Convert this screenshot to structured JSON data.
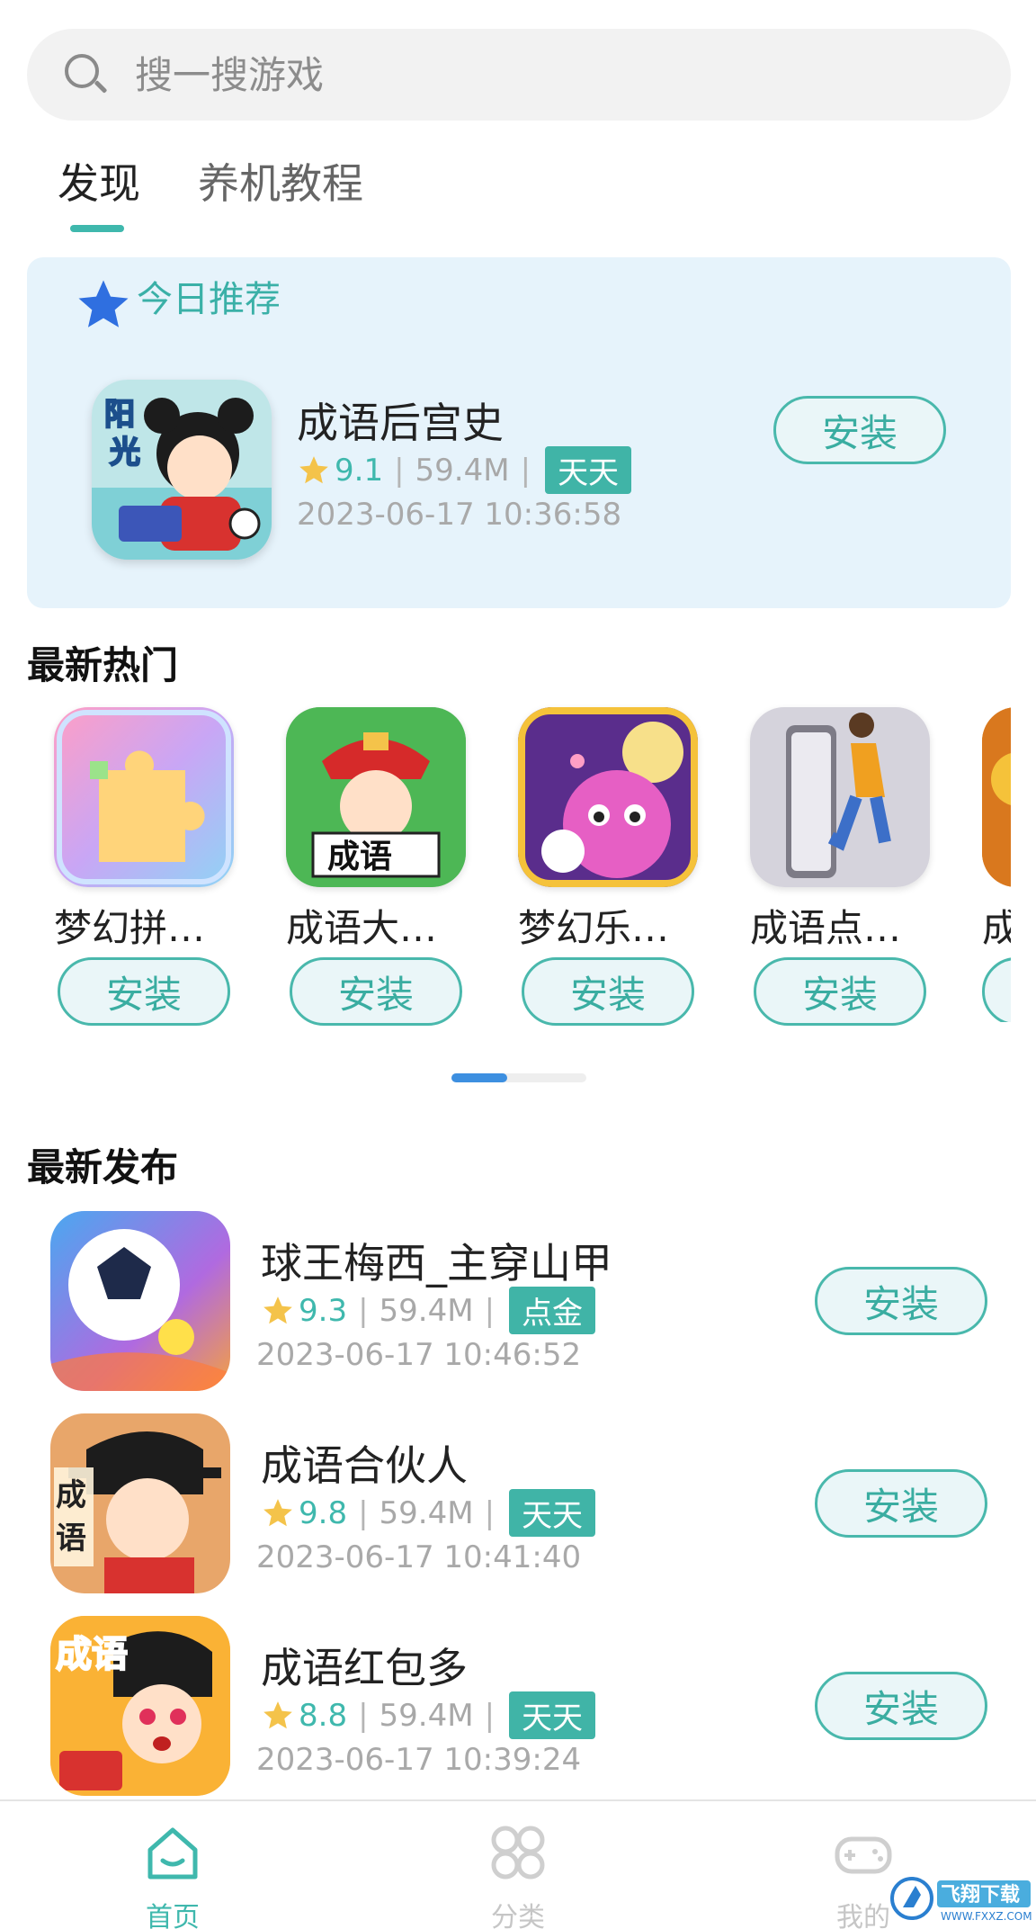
{
  "search": {
    "placeholder": "搜一搜游戏"
  },
  "tabs": [
    {
      "label": "发现",
      "active": true
    },
    {
      "label": "养机教程",
      "active": false
    }
  ],
  "recommend": {
    "title": "今日推荐",
    "game": {
      "name": "成语后宫史",
      "rating": "9.1",
      "size": "59.4M",
      "tag": "天天",
      "date": "2023-06-17 10:36:58",
      "install_label": "安装"
    }
  },
  "hot": {
    "title": "最新热门",
    "items": [
      {
        "name": "梦幻拼…",
        "install_label": "安装"
      },
      {
        "name": "成语大…",
        "install_label": "安装"
      },
      {
        "name": "梦幻乐…",
        "install_label": "安装"
      },
      {
        "name": "成语点…",
        "install_label": "安装"
      },
      {
        "name": "成",
        "install_label": ""
      }
    ]
  },
  "latest": {
    "title": "最新发布",
    "items": [
      {
        "name": "球王梅西_主穿山甲",
        "rating": "9.3",
        "size": "59.4M",
        "tag": "点金",
        "date": "2023-06-17 10:46:52",
        "install_label": "安装"
      },
      {
        "name": "成语合伙人",
        "rating": "9.8",
        "size": "59.4M",
        "tag": "天天",
        "date": "2023-06-17 10:41:40",
        "install_label": "安装"
      },
      {
        "name": "成语红包多",
        "rating": "8.8",
        "size": "59.4M",
        "tag": "天天",
        "date": "2023-06-17 10:39:24",
        "install_label": "安装"
      }
    ]
  },
  "meta_separator": "|",
  "nav": {
    "items": [
      {
        "label": "首页",
        "icon": "home-icon",
        "active": true
      },
      {
        "label": "分类",
        "icon": "category-icon",
        "active": false
      },
      {
        "label": "我的",
        "icon": "gamepad-icon",
        "active": false
      }
    ]
  },
  "watermark": {
    "text": "飞翔下载",
    "sub": "WWW.FXXZ.COM"
  },
  "colors": {
    "accent": "#3fb8ad",
    "card_bg": "#e6f3fb",
    "scroll_thumb": "#3d8fe0"
  }
}
